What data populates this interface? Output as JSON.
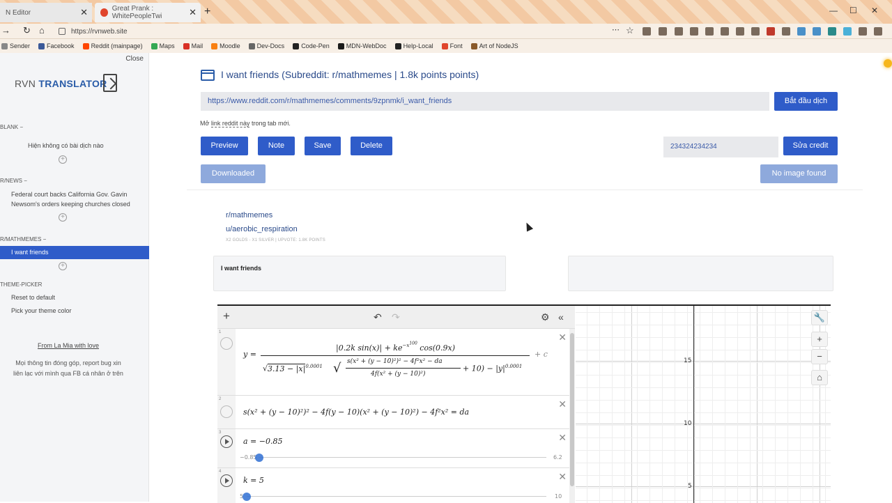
{
  "browser": {
    "tabs": [
      {
        "title": "N Editor"
      },
      {
        "title": "Great Prank : WhitePeopleTwi"
      }
    ],
    "new_tab": "+",
    "url": "https://rvnweb.site",
    "bookmarks": [
      {
        "label": "Sender",
        "color": "#888888"
      },
      {
        "label": "Facebook",
        "color": "#3b5998"
      },
      {
        "label": "Reddit (mainpage)",
        "color": "#ff4500"
      },
      {
        "label": "Maps",
        "color": "#34a853"
      },
      {
        "label": "Mail",
        "color": "#d93025"
      },
      {
        "label": "Moodle",
        "color": "#f98012"
      },
      {
        "label": "Dev-Docs",
        "color": "#666666"
      },
      {
        "label": "Code-Pen",
        "color": "#222222"
      },
      {
        "label": "MDN-WebDoc",
        "color": "#1b1b1b"
      },
      {
        "label": "Help-Local",
        "color": "#222222"
      },
      {
        "label": "Font",
        "color": "#e0452c"
      },
      {
        "label": "Art of NodeJS",
        "color": "#8a5a2a"
      }
    ]
  },
  "sidebar": {
    "close_label": "Close",
    "brand_prefix": "RVN",
    "brand_name": "TRANSLATOR",
    "sections": {
      "blank": {
        "label": "BLANK",
        "item": "Hiện không có bài dịch nào"
      },
      "news": {
        "label": "R/NEWS",
        "item": "Federal court backs California Gov. Gavin Newsom's orders keeping churches closed"
      },
      "mathmemes": {
        "label": "R/MATHMEMES",
        "item": "I want friends"
      },
      "theme": {
        "label": "THEME-PICKER",
        "items": [
          "Reset to default",
          "Pick your theme color"
        ]
      }
    },
    "footer_link": "From La Mia with love",
    "footer_text": "Mọi thông tin đóng góp, report bug xin liên lạc với mình qua FB cá nhân ở trên"
  },
  "main": {
    "title": "I want friends (Subreddit: r/mathmemes | 1.8k points points)",
    "post_url": "https://www.reddit.com/r/mathmemes/comments/9zpnmk/i_want_friends",
    "start_translate": "Bắt đầu dịch",
    "hint_prefix": "Mở",
    "hint_link": "link reddit này",
    "hint_suffix": "trong tab mới.",
    "buttons": {
      "preview": "Preview",
      "note": "Note",
      "save": "Save",
      "delete": "Delete",
      "downloaded": "Downloaded",
      "edit_credit": "Sửa credit",
      "no_image": "No image found"
    },
    "credit_value": "234324234234",
    "subreddit": "r/mathmemes",
    "author": "u/aerobic_respiration",
    "meta": "X2 GOLDS - X1 SILVER | UPVOTE: 1.8K POINTS",
    "card_left": "I want friends",
    "card_right": ""
  },
  "desmos": {
    "expr1": {
      "lhs": "y =",
      "numerator": "|0.2k sin(x)| + ke",
      "numerator_exp": "−x",
      "numerator_exp2": "100",
      "numerator_tail": "cos(0.9x)",
      "den_sqrt": "3.13 − |x|",
      "den_exp": "0.0001",
      "inner_num": "s(x² + (y − 10)²)² − 4f²x² − da",
      "inner_den": "4f(x² + (y − 10)²)",
      "inner_tail": "+ 10) − |y|",
      "outer_exp": "0.0001",
      "tail": "+ c"
    },
    "expr2": "s(x² + (y − 10)²)² − 4f(y − 10)(x² + (y − 10)²) − 4f²x² = da",
    "expr3": {
      "text": "a = −0.85",
      "min": "−0.85",
      "max": "6.2",
      "value": 0.0
    },
    "expr4": {
      "text": "k = 5",
      "min": "5",
      "max": "10",
      "value": 0.0
    },
    "y_ticks": [
      "15",
      "10",
      "5"
    ]
  }
}
